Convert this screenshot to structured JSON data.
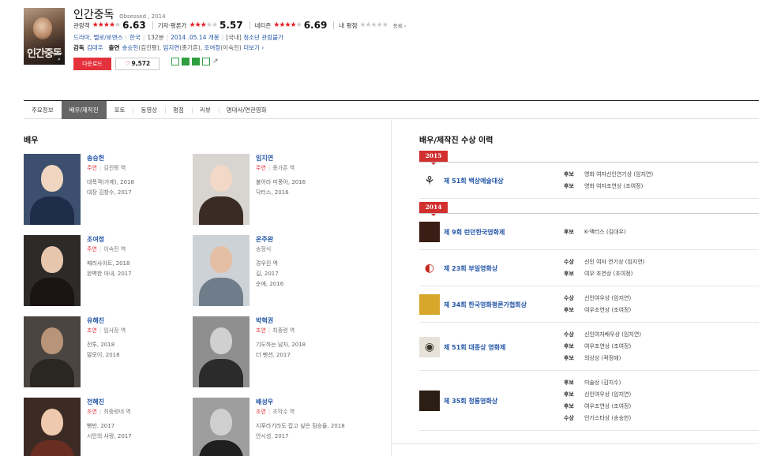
{
  "movie": {
    "poster_text": "인간중독",
    "title": "인간중독",
    "title_en": "Obsessed , 2014",
    "ratings": [
      {
        "label": "관람객",
        "stars": 3.5,
        "score": "6.63"
      },
      {
        "label": "기자·평론가",
        "stars": 3,
        "score": "5.57"
      },
      {
        "label": "네티즌",
        "stars": 3.5,
        "score": "6.69"
      },
      {
        "label": "내 평점",
        "stars": 0,
        "score": ""
      }
    ],
    "rate_link": "등록",
    "genre": "드라마, 멜로/로맨스",
    "country": "한국",
    "runtime": "132분",
    "release": "2014 .05.14 개봉",
    "grade_prefix": "[국내]",
    "grade": "청소년 관람불가",
    "director_label": "감독",
    "director": "김대우",
    "cast_label": "출연",
    "cast": [
      {
        "name": "송승헌",
        "role": "(김진평)"
      },
      {
        "name": "임지연",
        "role": "(종가흔)"
      },
      {
        "name": "조여정",
        "role": "(이숙진)"
      }
    ],
    "cast_more": "더보기",
    "download_label": "다운로드",
    "like_count": "9,572"
  },
  "tabs": [
    "주요정보",
    "배우/제작진",
    "포토",
    "동영상",
    "평점",
    "리뷰",
    "명대사/연관영화"
  ],
  "active_tab": 1,
  "actors_title": "배우",
  "actors": [
    {
      "name": "송승헌",
      "type": "주연",
      "role": "김진평 역",
      "works": [
        "대폭격(가제), 2018",
        "대장 김창수, 2017"
      ]
    },
    {
      "name": "임지연",
      "type": "주연",
      "role": "종가흔 역",
      "works": [
        "불어라 미풍아, 2016",
        "닥터스, 2016"
      ]
    },
    {
      "name": "조여정",
      "type": "주연",
      "role": "이숙진 역",
      "works": [
        "패러사이트, 2018",
        "완벽한 아내, 2017"
      ]
    },
    {
      "name": "온주완",
      "type": "",
      "role": "송정식",
      "works": [
        "경우진 역",
        "길, 2017",
        "순애, 2016"
      ]
    },
    {
      "name": "유해진",
      "type": "조연",
      "role": "임사장 역",
      "works": [
        "전투, 2018",
        "말모이, 2018"
      ]
    },
    {
      "name": "박혁권",
      "type": "조연",
      "role": "최중령 역",
      "works": [
        "기도하는 남자, 2018",
        "더 펜션, 2017"
      ]
    },
    {
      "name": "전혜진",
      "type": "조연",
      "role": "최중령네 역",
      "works": [
        "뻥반, 2017",
        "시인의 사랑, 2017"
      ]
    },
    {
      "name": "배성우",
      "type": "조연",
      "role": "조막수 역",
      "works": [
        "지푸라기라도 잡고 싶은 짐승들, 2018",
        "안시성, 2017"
      ]
    }
  ],
  "awards_title": "배우/제작진 수상 이력",
  "award_years": [
    {
      "year": "2015",
      "items": [
        {
          "name": "제 51회 백상예술대상",
          "list": [
            {
              "status": "후보",
              "cat": "영화 여자신인연기상 (임지연)"
            },
            {
              "status": "후보",
              "cat": "영화 여자조연상 (조여정)"
            }
          ]
        }
      ]
    },
    {
      "year": "2014",
      "items": [
        {
          "name": "제 9회 런던한국영화제",
          "list": [
            {
              "status": "후보",
              "cat": "K-액터스 (김대우)"
            }
          ]
        },
        {
          "name": "제 23회 부일영화상",
          "list": [
            {
              "status": "수상",
              "cat": "신인 여자 연기상 (임지연)"
            },
            {
              "status": "후보",
              "cat": "여우 조연상 (조여정)"
            }
          ]
        },
        {
          "name": "제 34회 한국영화평론가협회상",
          "list": [
            {
              "status": "수상",
              "cat": "신인여우상 (임지연)"
            },
            {
              "status": "후보",
              "cat": "여우조연상 (조여정)"
            }
          ]
        },
        {
          "name": "제 51회 대종상 영화제",
          "list": [
            {
              "status": "수상",
              "cat": "신인여자배우상 (임지연)"
            },
            {
              "status": "후보",
              "cat": "여우조연상 (조여정)"
            },
            {
              "status": "후보",
              "cat": "의상상 (곽정애)"
            }
          ]
        },
        {
          "name": "제 35회 청룡영화상",
          "list": [
            {
              "status": "후보",
              "cat": "미술상 (김지수)"
            },
            {
              "status": "후보",
              "cat": "신인여우상 (임지연)"
            },
            {
              "status": "후보",
              "cat": "여우조연상 (조여정)"
            },
            {
              "status": "수상",
              "cat": "인기스타상 (송승헌)"
            }
          ]
        }
      ]
    }
  ],
  "colors": {
    "accent": "#e4323c",
    "link": "#2456a6",
    "tab_active": "#666666"
  }
}
